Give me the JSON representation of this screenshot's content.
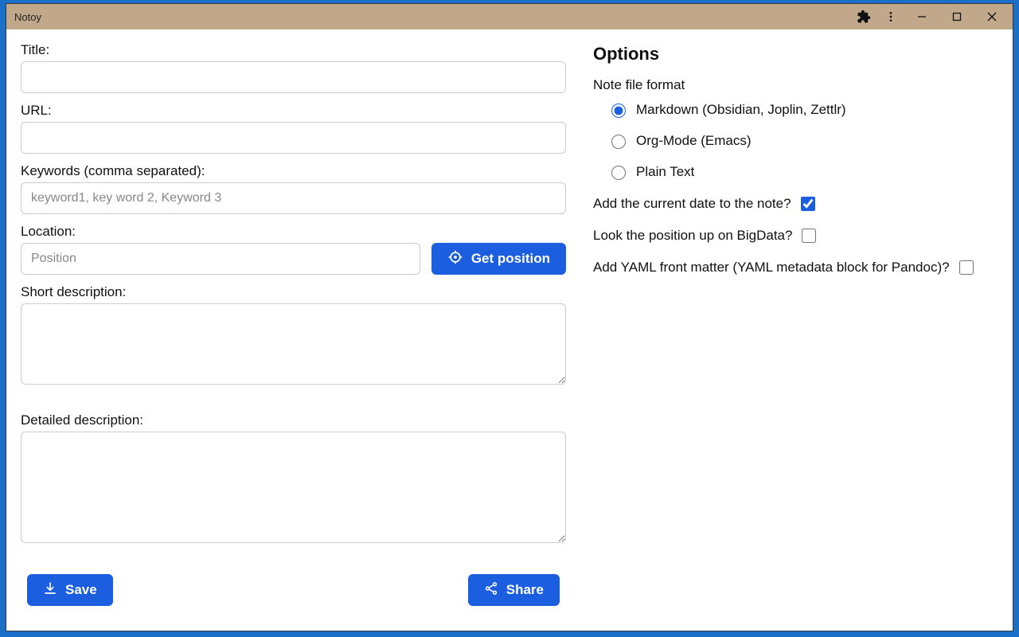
{
  "window": {
    "title": "Notoy"
  },
  "form": {
    "title_label": "Title:",
    "title_value": "",
    "url_label": "URL:",
    "url_value": "",
    "keywords_label": "Keywords (comma separated):",
    "keywords_placeholder": "keyword1, key word 2, Keyword 3",
    "keywords_value": "",
    "location_label": "Location:",
    "location_placeholder": "Position",
    "location_value": "",
    "get_position_label": "Get position",
    "short_desc_label": "Short description:",
    "short_desc_value": "",
    "detailed_desc_label": "Detailed description:",
    "detailed_desc_value": "",
    "save_label": "Save",
    "share_label": "Share"
  },
  "options": {
    "heading": "Options",
    "format_label": "Note file format",
    "radios": {
      "markdown": "Markdown (Obsidian, Joplin, Zettlr)",
      "orgmode": "Org-Mode (Emacs)",
      "plaintext": "Plain Text"
    },
    "selected_format": "markdown",
    "add_date_label": "Add the current date to the note?",
    "add_date_checked": true,
    "bigdata_label": "Look the position up on BigData?",
    "bigdata_checked": false,
    "yaml_label": "Add YAML front matter (YAML metadata block for Pandoc)?",
    "yaml_checked": false
  }
}
